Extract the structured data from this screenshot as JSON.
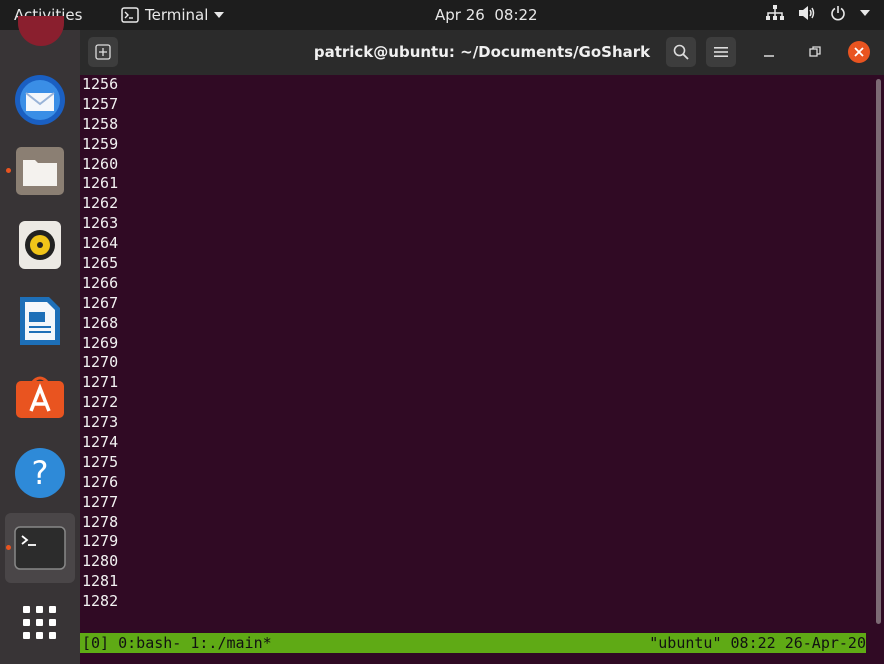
{
  "topbar": {
    "activities": "Activities",
    "app_name": "Terminal",
    "date": "Apr 26",
    "time": "08:22"
  },
  "dock": {
    "items": [
      {
        "name": "thunderbird-icon"
      },
      {
        "name": "files-icon"
      },
      {
        "name": "rhythmbox-icon"
      },
      {
        "name": "libreoffice-writer-icon"
      },
      {
        "name": "software-center-icon"
      },
      {
        "name": "help-icon"
      },
      {
        "name": "terminal-icon"
      },
      {
        "name": "show-applications-icon"
      }
    ]
  },
  "window": {
    "title": "patrick@ubuntu: ~/Documents/GoShark"
  },
  "terminal": {
    "lines": [
      "1256",
      "1257",
      "1258",
      "1259",
      "1260",
      "1261",
      "1262",
      "1263",
      "1264",
      "1265",
      "1266",
      "1267",
      "1268",
      "1269",
      "1270",
      "1271",
      "1272",
      "1273",
      "1274",
      "1275",
      "1276",
      "1277",
      "1278",
      "1279",
      "1280",
      "1281",
      "1282"
    ]
  },
  "tmux": {
    "left": "[0] 0:bash- 1:./main*",
    "right": "\"ubuntu\" 08:22 26-Apr-20"
  },
  "colors": {
    "terminal_bg": "#300a24",
    "tmux_bar": "#5faa15",
    "accent": "#e95420"
  }
}
